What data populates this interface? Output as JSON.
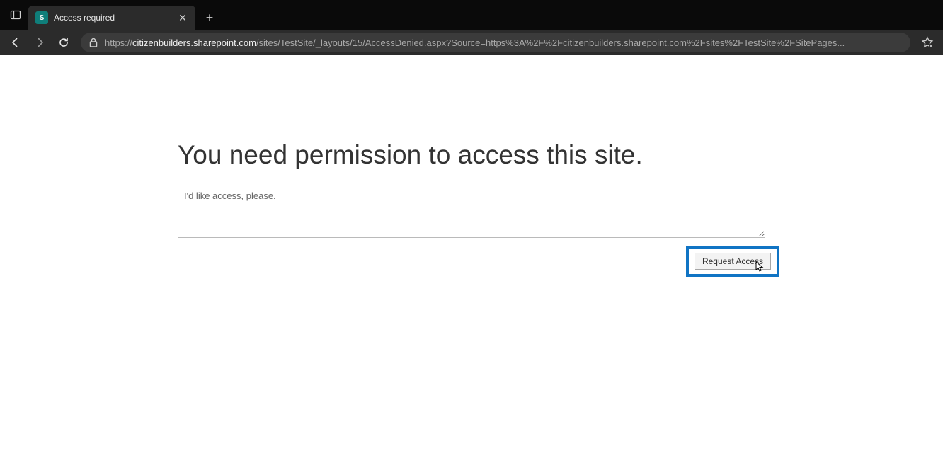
{
  "browser": {
    "tab": {
      "favicon_letter": "S",
      "title": "Access required"
    },
    "url": {
      "protocol": "https://",
      "domain": "citizenbuilders.sharepoint.com",
      "path": "/sites/TestSite/_layouts/15/AccessDenied.aspx?Source=https%3A%2F%2Fcitizenbuilders.sharepoint.com%2Fsites%2FTestSite%2FSitePages..."
    }
  },
  "page": {
    "heading": "You need permission to access this site.",
    "textarea_placeholder": "I'd like access, please.",
    "request_button_label": "Request Access"
  }
}
